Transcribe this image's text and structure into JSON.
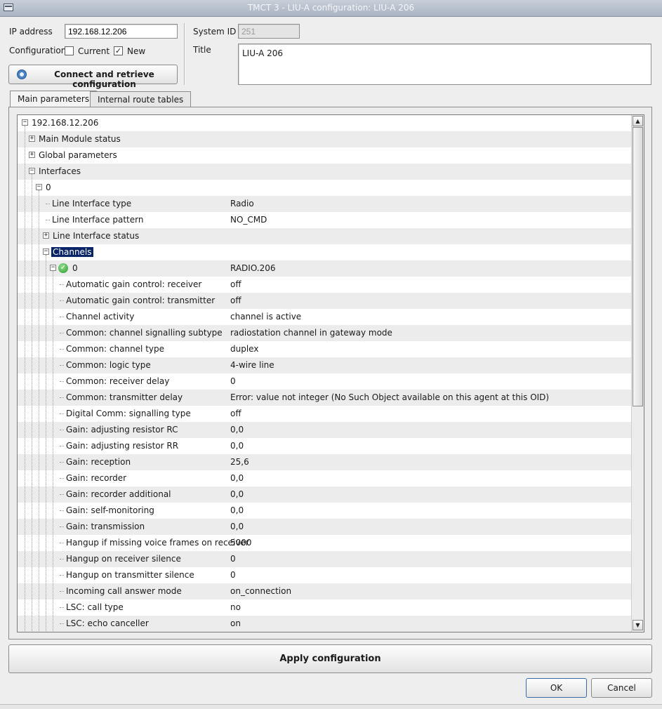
{
  "window": {
    "title": "TMCT 3 - LIU-A configuration: LIU-A 206"
  },
  "connection": {
    "ip_label": "IP address",
    "ip_value": "192.168.12.206",
    "config_label": "Configuration",
    "current_label": "Current",
    "current_checked": false,
    "new_label": "New",
    "new_checked": true,
    "connect_button": "Connect and retrieve configuration"
  },
  "system": {
    "system_id_label": "System ID",
    "system_id_value": "251",
    "title_label": "Title",
    "title_value": "LIU-A 206"
  },
  "tabs": [
    {
      "label": "Main parameters",
      "active": true
    },
    {
      "label": "Internal route tables",
      "active": false
    }
  ],
  "tree": {
    "rows": [
      {
        "depth": 0,
        "expander": "minus",
        "name": "192.168.12.206",
        "value": ""
      },
      {
        "depth": 1,
        "expander": "plus",
        "name": "Main Module status",
        "value": ""
      },
      {
        "depth": 1,
        "expander": "plus",
        "name": "Global parameters",
        "value": ""
      },
      {
        "depth": 1,
        "expander": "minus",
        "name": "Interfaces",
        "value": ""
      },
      {
        "depth": 2,
        "expander": "minus",
        "name": "0",
        "value": ""
      },
      {
        "depth": 3,
        "expander": "none",
        "name": "Line Interface type",
        "value": "Radio"
      },
      {
        "depth": 3,
        "expander": "none",
        "name": "Line Interface pattern",
        "value": "NO_CMD"
      },
      {
        "depth": 3,
        "expander": "plus",
        "name": "Line Interface status",
        "value": ""
      },
      {
        "depth": 3,
        "expander": "minus",
        "name": "Channels",
        "value": "",
        "selected": true
      },
      {
        "depth": 4,
        "expander": "minus",
        "name": "0",
        "value": "RADIO.206",
        "status_icon": "check-icon"
      },
      {
        "depth": 5,
        "expander": "none",
        "name": "Automatic gain control: receiver",
        "value": "off"
      },
      {
        "depth": 5,
        "expander": "none",
        "name": "Automatic gain control: transmitter",
        "value": "off"
      },
      {
        "depth": 5,
        "expander": "none",
        "name": "Channel activity",
        "value": "channel is active"
      },
      {
        "depth": 5,
        "expander": "none",
        "name": "Common: channel signalling subtype",
        "value": "radiostation channel in gateway mode"
      },
      {
        "depth": 5,
        "expander": "none",
        "name": "Common: channel type",
        "value": "duplex"
      },
      {
        "depth": 5,
        "expander": "none",
        "name": "Common: logic type",
        "value": "4-wire line"
      },
      {
        "depth": 5,
        "expander": "none",
        "name": "Common: receiver delay",
        "value": "0"
      },
      {
        "depth": 5,
        "expander": "none",
        "name": "Common: transmitter delay",
        "value": "Error: value not integer (No Such Object available on this agent at this OID)"
      },
      {
        "depth": 5,
        "expander": "none",
        "name": "Digital Comm: signalling type",
        "value": "off"
      },
      {
        "depth": 5,
        "expander": "none",
        "name": "Gain: adjusting resistor RC",
        "value": "0,0"
      },
      {
        "depth": 5,
        "expander": "none",
        "name": "Gain: adjusting resistor RR",
        "value": "0,0"
      },
      {
        "depth": 5,
        "expander": "none",
        "name": "Gain: reception",
        "value": "25,6"
      },
      {
        "depth": 5,
        "expander": "none",
        "name": "Gain: recorder",
        "value": "0,0"
      },
      {
        "depth": 5,
        "expander": "none",
        "name": "Gain: recorder additional",
        "value": "0,0"
      },
      {
        "depth": 5,
        "expander": "none",
        "name": "Gain: self-monitoring",
        "value": "0,0"
      },
      {
        "depth": 5,
        "expander": "none",
        "name": "Gain: transmission",
        "value": "0,0"
      },
      {
        "depth": 5,
        "expander": "none",
        "name": "Hangup if missing voice frames on receiver",
        "value": "5000"
      },
      {
        "depth": 5,
        "expander": "none",
        "name": "Hangup on receiver silence",
        "value": "0"
      },
      {
        "depth": 5,
        "expander": "none",
        "name": "Hangup on transmitter silence",
        "value": "0"
      },
      {
        "depth": 5,
        "expander": "none",
        "name": "Incoming call answer mode",
        "value": "on_connection"
      },
      {
        "depth": 5,
        "expander": "none",
        "name": "LSC: call type",
        "value": "no"
      },
      {
        "depth": 5,
        "expander": "none",
        "name": "LSC: echo canceller",
        "value": "on"
      }
    ]
  },
  "footer": {
    "apply_button": "Apply configuration",
    "ok_button": "OK",
    "cancel_button": "Cancel"
  }
}
